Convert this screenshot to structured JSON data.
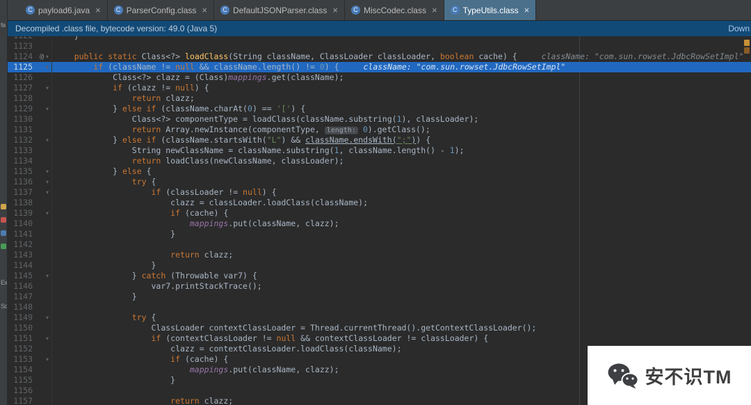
{
  "meta": {
    "app": "intellij-idea-darcula-editor"
  },
  "colors": {
    "editor_bg": "#2b2b2b",
    "gutter_number": "#606366",
    "highlight_line": "#2068c0",
    "banner_bg": "#124a77",
    "tab_bar_bg": "#3c3f41",
    "tab_active_bg": "#4a708c",
    "keyword": "#cc7832",
    "string": "#6a8759",
    "number": "#6897bb",
    "field": "#9876aa",
    "code_text": "#a9b7c6"
  },
  "tabs": [
    {
      "label": "payload6.java",
      "icon_letter": "C",
      "close": "×",
      "active": false
    },
    {
      "label": "ParserConfig.class",
      "icon_letter": "C",
      "close": "×",
      "active": false
    },
    {
      "label": "DefaultJSONParser.class",
      "icon_letter": "C",
      "close": "×",
      "active": false
    },
    {
      "label": "MiscCodec.class",
      "icon_letter": "C",
      "close": "×",
      "active": false
    },
    {
      "label": "TypeUtils.class",
      "icon_letter": "C",
      "close": "×",
      "active": true
    }
  ],
  "banner": {
    "text": "Decompiled .class file, bytecode version: 49.0 (Java 5)",
    "link": "Down"
  },
  "stripe": {
    "top_label": "fa",
    "icons": [
      "#d0a54b",
      "#c75450",
      "#4e7bb3",
      "#499c54"
    ],
    "labels": [
      "Ex",
      "Sc"
    ]
  },
  "watermark": {
    "text": "安不识TM",
    "icon": "wechat-icon"
  },
  "editor": {
    "lines": [
      {
        "n": 1122,
        "tokens": [
          [
            "p",
            "    }"
          ]
        ]
      },
      {
        "n": 1123,
        "tokens": []
      },
      {
        "n": 1124,
        "icon": "@",
        "fold": true,
        "tokens": [
          [
            "p",
            "    "
          ],
          [
            "k",
            "public"
          ],
          [
            "p",
            " "
          ],
          [
            "k",
            "static"
          ],
          [
            "p",
            " Class<?> "
          ],
          [
            "m",
            "loadClass"
          ],
          [
            "p",
            "(String className, ClassLoader classLoader, "
          ],
          [
            "k",
            "boolean"
          ],
          [
            "p",
            " cache) { "
          ],
          [
            "d",
            "className: \"com.sun.rowset.JdbcRowSetImpl\"   classLoader: null"
          ]
        ]
      },
      {
        "n": 1125,
        "hl": true,
        "fold": true,
        "tokens": [
          [
            "p",
            "        "
          ],
          [
            "k",
            "if"
          ],
          [
            "p",
            " (className != "
          ],
          [
            "k",
            "null"
          ],
          [
            "p",
            " && className.length() != "
          ],
          [
            "n",
            "0"
          ],
          [
            "p",
            ") { "
          ],
          [
            "d",
            "className: \"com.sun.rowset.JdbcRowSetImpl\""
          ]
        ]
      },
      {
        "n": 1126,
        "tokens": [
          [
            "p",
            "            Class<?> clazz = (Class)"
          ],
          [
            "f",
            "mappings"
          ],
          [
            "p",
            ".get(className);"
          ]
        ]
      },
      {
        "n": 1127,
        "fold": true,
        "tokens": [
          [
            "p",
            "            "
          ],
          [
            "k",
            "if"
          ],
          [
            "p",
            " (clazz != "
          ],
          [
            "k",
            "null"
          ],
          [
            "p",
            ") {"
          ]
        ]
      },
      {
        "n": 1128,
        "tokens": [
          [
            "p",
            "                "
          ],
          [
            "k",
            "return"
          ],
          [
            "p",
            " clazz;"
          ]
        ]
      },
      {
        "n": 1129,
        "fold": true,
        "tokens": [
          [
            "p",
            "            } "
          ],
          [
            "k",
            "else"
          ],
          [
            "p",
            " "
          ],
          [
            "k",
            "if"
          ],
          [
            "p",
            " (className.charAt("
          ],
          [
            "n",
            "0"
          ],
          [
            "p",
            ") == "
          ],
          [
            "s",
            "'['"
          ],
          [
            "p",
            ") {"
          ]
        ]
      },
      {
        "n": 1130,
        "tokens": [
          [
            "p",
            "                Class<?> componentType = loadClass(className.substring("
          ],
          [
            "n",
            "1"
          ],
          [
            "p",
            "), classLoader);"
          ]
        ]
      },
      {
        "n": 1131,
        "tokens": [
          [
            "p",
            "                "
          ],
          [
            "k",
            "return"
          ],
          [
            "p",
            " Array.newInstance(componentType, "
          ],
          [
            "h",
            "length:"
          ],
          [
            "p",
            " "
          ],
          [
            "n",
            "0"
          ],
          [
            "p",
            ").getClass();"
          ]
        ]
      },
      {
        "n": 1132,
        "fold": true,
        "tokens": [
          [
            "p",
            "            } "
          ],
          [
            "k",
            "else"
          ],
          [
            "p",
            " "
          ],
          [
            "k",
            "if"
          ],
          [
            "p",
            " (className.startsWith("
          ],
          [
            "s",
            "\"L\""
          ],
          [
            "p",
            ") && "
          ],
          [
            "u",
            "className.endsWith("
          ],
          [
            "v",
            "\";\""
          ],
          [
            "u",
            ")"
          ],
          [
            "p",
            ") {"
          ]
        ]
      },
      {
        "n": 1133,
        "tokens": [
          [
            "p",
            "                String newClassName = className.substring("
          ],
          [
            "n",
            "1"
          ],
          [
            "p",
            ", className.length() - "
          ],
          [
            "n",
            "1"
          ],
          [
            "p",
            ");"
          ]
        ]
      },
      {
        "n": 1134,
        "tokens": [
          [
            "p",
            "                "
          ],
          [
            "k",
            "return"
          ],
          [
            "p",
            " loadClass(newClassName, classLoader);"
          ]
        ]
      },
      {
        "n": 1135,
        "fold": true,
        "tokens": [
          [
            "p",
            "            } "
          ],
          [
            "k",
            "else"
          ],
          [
            "p",
            " {"
          ]
        ]
      },
      {
        "n": 1136,
        "fold": true,
        "tokens": [
          [
            "p",
            "                "
          ],
          [
            "k",
            "try"
          ],
          [
            "p",
            " {"
          ]
        ]
      },
      {
        "n": 1137,
        "fold": true,
        "tokens": [
          [
            "p",
            "                    "
          ],
          [
            "k",
            "if"
          ],
          [
            "p",
            " (classLoader != "
          ],
          [
            "k",
            "null"
          ],
          [
            "p",
            ") {"
          ]
        ]
      },
      {
        "n": 1138,
        "tokens": [
          [
            "p",
            "                        clazz = classLoader.loadClass(className);"
          ]
        ]
      },
      {
        "n": 1139,
        "fold": true,
        "tokens": [
          [
            "p",
            "                        "
          ],
          [
            "k",
            "if"
          ],
          [
            "p",
            " (cache) {"
          ]
        ]
      },
      {
        "n": 1140,
        "tokens": [
          [
            "p",
            "                            "
          ],
          [
            "f",
            "mappings"
          ],
          [
            "p",
            ".put(className, clazz);"
          ]
        ]
      },
      {
        "n": 1141,
        "tokens": [
          [
            "p",
            "                        }"
          ]
        ]
      },
      {
        "n": 1142,
        "tokens": []
      },
      {
        "n": 1143,
        "tokens": [
          [
            "p",
            "                        "
          ],
          [
            "k",
            "return"
          ],
          [
            "p",
            " clazz;"
          ]
        ]
      },
      {
        "n": 1144,
        "tokens": [
          [
            "p",
            "                    }"
          ]
        ]
      },
      {
        "n": 1145,
        "fold": true,
        "tokens": [
          [
            "p",
            "                } "
          ],
          [
            "k",
            "catch"
          ],
          [
            "p",
            " (Throwable var7) {"
          ]
        ]
      },
      {
        "n": 1146,
        "tokens": [
          [
            "p",
            "                    var7.printStackTrace();"
          ]
        ]
      },
      {
        "n": 1147,
        "tokens": [
          [
            "p",
            "                }"
          ]
        ]
      },
      {
        "n": 1148,
        "tokens": []
      },
      {
        "n": 1149,
        "fold": true,
        "tokens": [
          [
            "p",
            "                "
          ],
          [
            "k",
            "try"
          ],
          [
            "p",
            " {"
          ]
        ]
      },
      {
        "n": 1150,
        "tokens": [
          [
            "p",
            "                    ClassLoader contextClassLoader = Thread.currentThread().getContextClassLoader();"
          ]
        ]
      },
      {
        "n": 1151,
        "fold": true,
        "tokens": [
          [
            "p",
            "                    "
          ],
          [
            "k",
            "if"
          ],
          [
            "p",
            " (contextClassLoader != "
          ],
          [
            "k",
            "null"
          ],
          [
            "p",
            " && contextClassLoader != classLoader) {"
          ]
        ]
      },
      {
        "n": 1152,
        "tokens": [
          [
            "p",
            "                        clazz = contextClassLoader.loadClass(className);"
          ]
        ]
      },
      {
        "n": 1153,
        "fold": true,
        "tokens": [
          [
            "p",
            "                        "
          ],
          [
            "k",
            "if"
          ],
          [
            "p",
            " (cache) {"
          ]
        ]
      },
      {
        "n": 1154,
        "tokens": [
          [
            "p",
            "                            "
          ],
          [
            "f",
            "mappings"
          ],
          [
            "p",
            ".put(className, clazz);"
          ]
        ]
      },
      {
        "n": 1155,
        "tokens": [
          [
            "p",
            "                        }"
          ]
        ]
      },
      {
        "n": 1156,
        "tokens": []
      },
      {
        "n": 1157,
        "tokens": [
          [
            "p",
            "                        "
          ],
          [
            "k",
            "return"
          ],
          [
            "p",
            " clazz;"
          ]
        ]
      }
    ]
  }
}
